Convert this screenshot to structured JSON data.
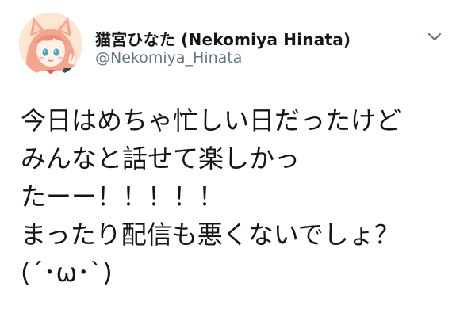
{
  "user": {
    "display_name": "猫宮ひなた (Nekomiya Hinata)",
    "handle": "@Nekomiya_Hinata"
  },
  "icons": {
    "avatar": "avatar-image",
    "menu": "chevron-down-icon"
  },
  "tweet": {
    "lines": [
      "今日はめちゃ忙しい日だったけど",
      "みんなと話せて楽しかっ",
      "たーー！！！！！",
      "まったり配信も悪くないでしょ？",
      "(´･ω･`)"
    ]
  },
  "colors": {
    "handle": "#657786",
    "text": "#14171a",
    "caret": "#657786"
  }
}
